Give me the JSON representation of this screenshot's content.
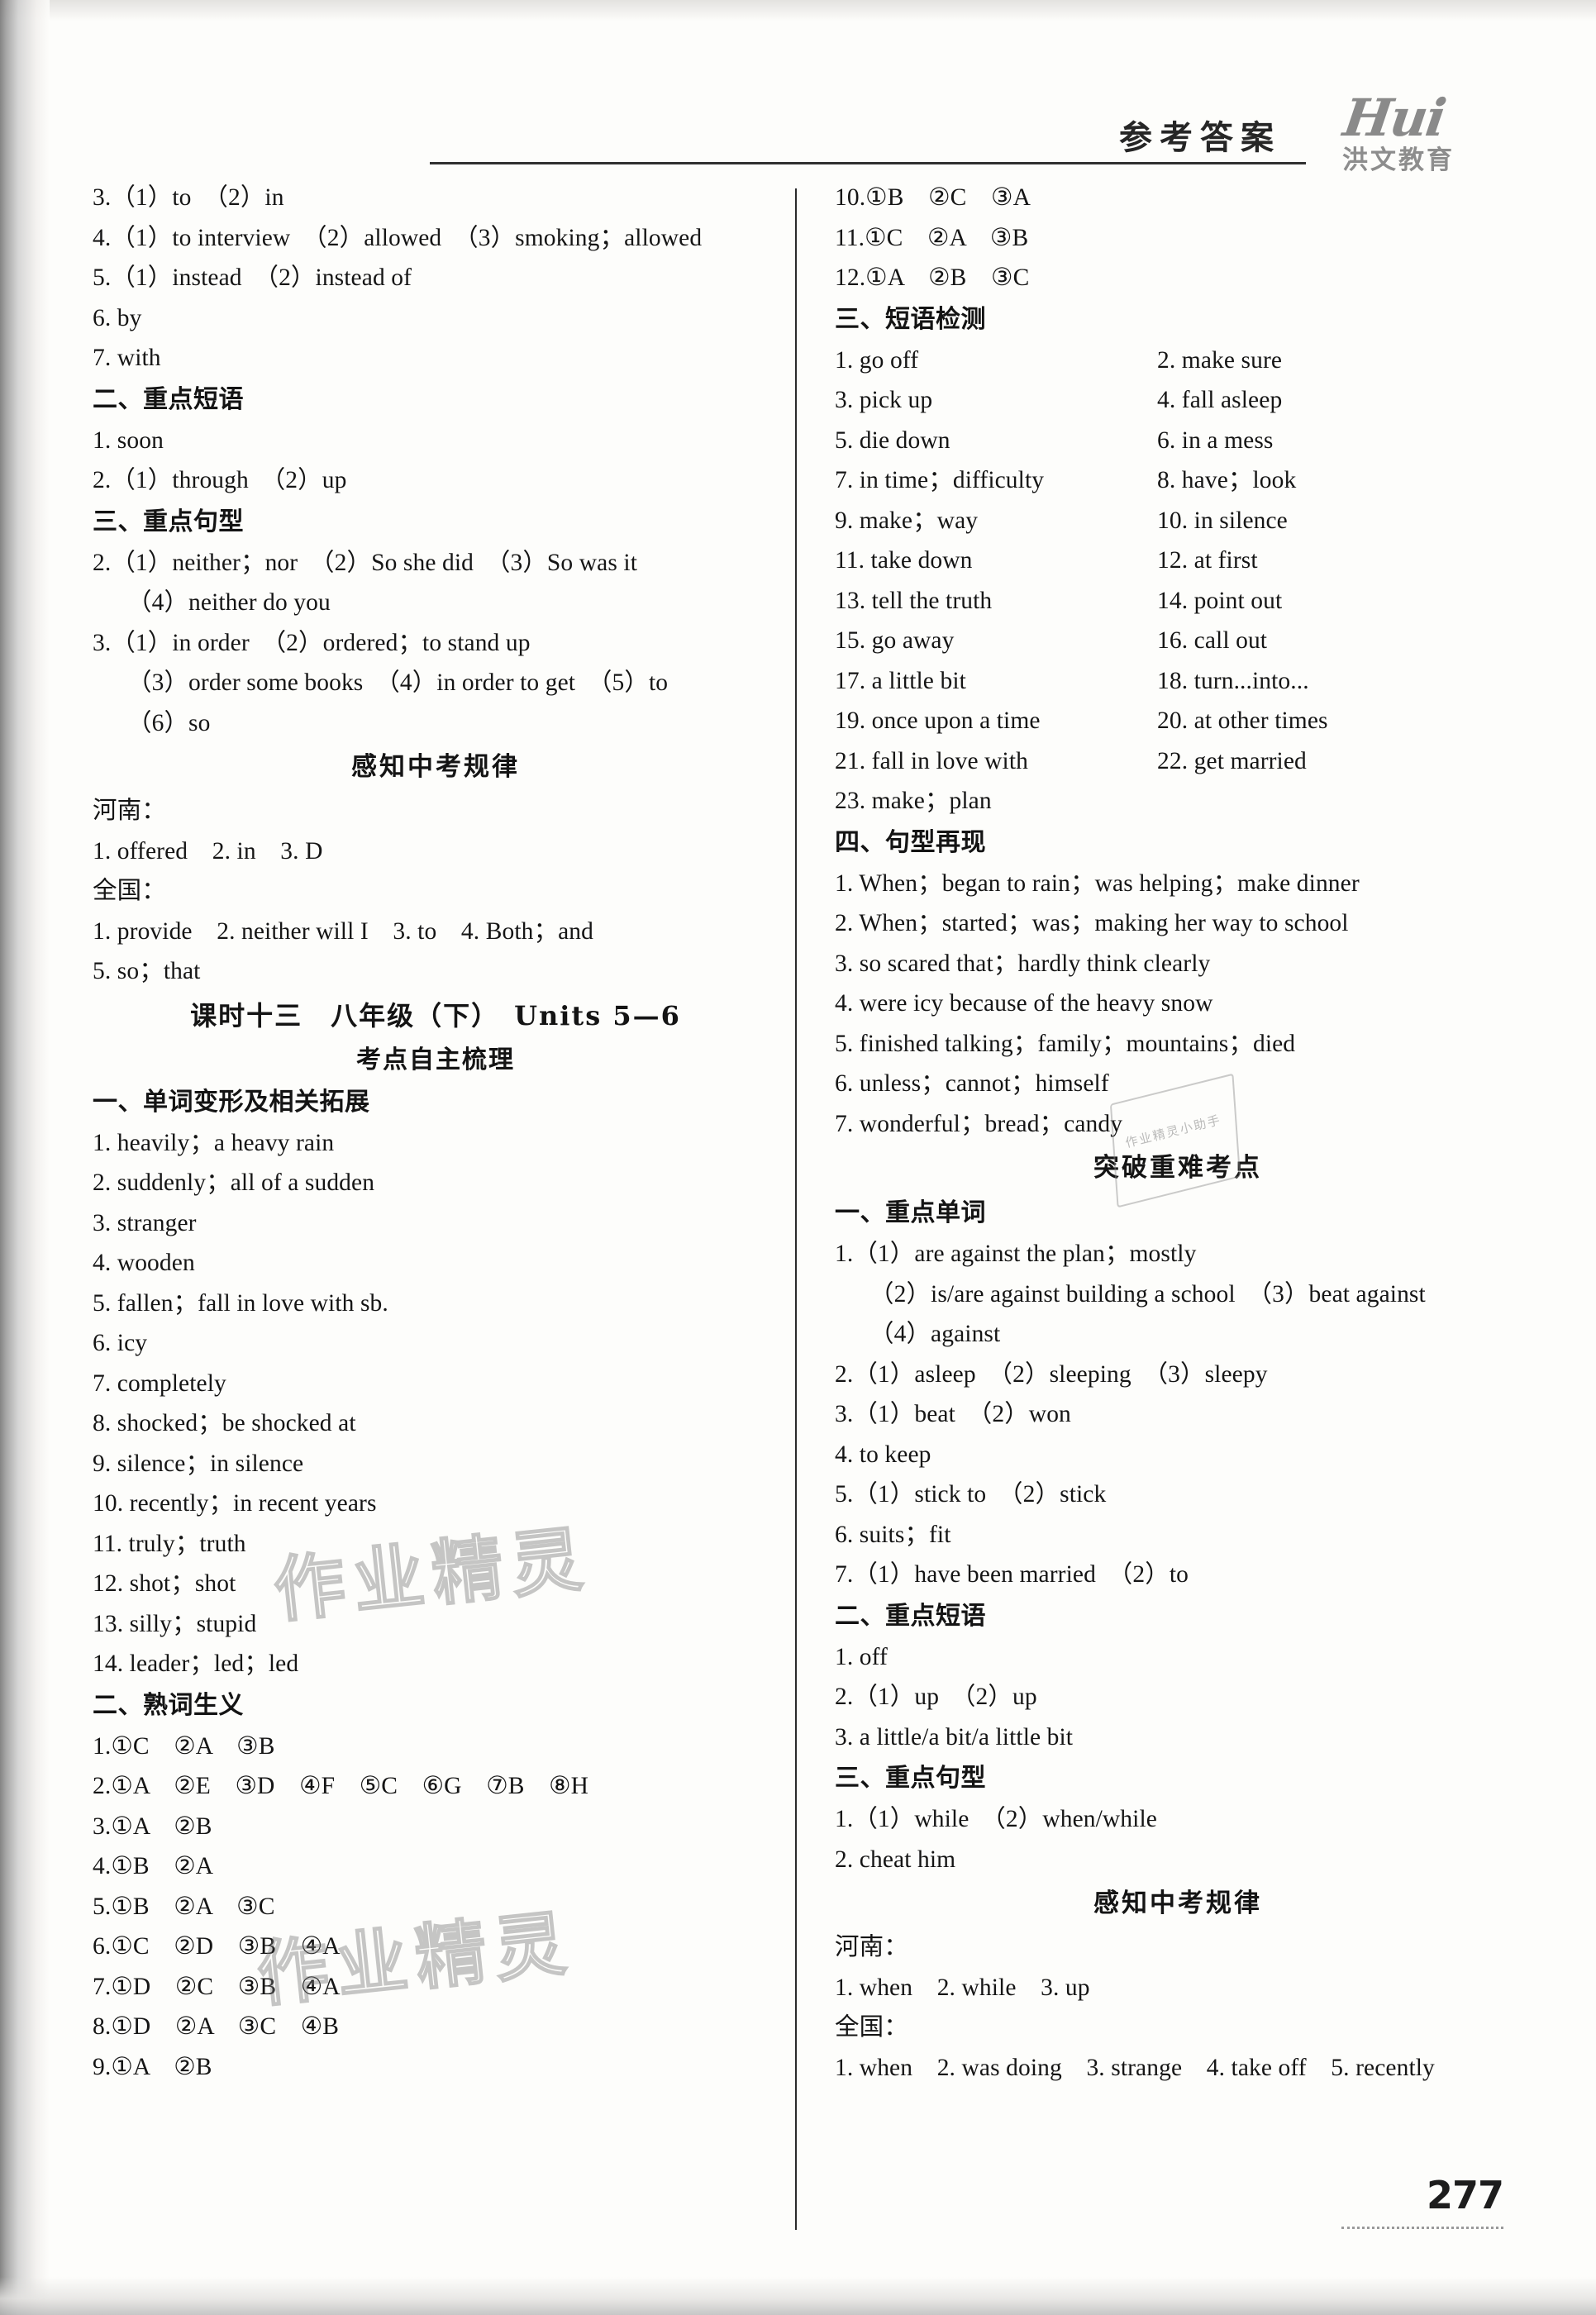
{
  "header": {
    "title": "参考答案",
    "logo_script": "Hui",
    "logo_sub": "洪文教育"
  },
  "page_number": "277",
  "watermarks": {
    "a": "作业精灵",
    "b": "作业精灵",
    "c": "作业精灵小助手"
  },
  "left_column": [
    {
      "type": "line",
      "text": "3.（1）to　（2）in"
    },
    {
      "type": "line",
      "text": "4.（1）to interview　（2）allowed　（3）smoking；allowed"
    },
    {
      "type": "line",
      "text": "5.（1）instead　（2）instead of"
    },
    {
      "type": "line",
      "text": "6. by"
    },
    {
      "type": "line",
      "text": "7. with"
    },
    {
      "type": "sec-head",
      "text": "二、重点短语"
    },
    {
      "type": "line",
      "text": "1. soon"
    },
    {
      "type": "line",
      "text": "2.（1）through　（2）up"
    },
    {
      "type": "sec-head",
      "text": "三、重点句型"
    },
    {
      "type": "line",
      "text": "2.（1）neither；nor　（2）So she did　（3）So was it"
    },
    {
      "type": "line-indent",
      "text": "（4）neither do you"
    },
    {
      "type": "line",
      "text": "3.（1）in order　（2）ordered；to stand up"
    },
    {
      "type": "line-indent",
      "text": "（3）order some books　（4）in order to get　（5）to"
    },
    {
      "type": "line-indent",
      "text": "（6）so"
    },
    {
      "type": "center-head",
      "text": "感知中考规律"
    },
    {
      "type": "line",
      "text": "河南："
    },
    {
      "type": "line",
      "text": "1. offered　2. in　3. D"
    },
    {
      "type": "line",
      "text": "全国："
    },
    {
      "type": "line",
      "text": "1. provide　2. neither will I　3. to　4. Both；and"
    },
    {
      "type": "line",
      "text": "5. so；that"
    },
    {
      "type": "center-head-serif",
      "text": "课时十三　八年级（下）　Units 5—6"
    },
    {
      "type": "center-sub",
      "text": "考点自主梳理"
    },
    {
      "type": "sec-head",
      "text": "一、单词变形及相关拓展"
    },
    {
      "type": "line",
      "text": "1. heavily；a heavy rain"
    },
    {
      "type": "line",
      "text": "2. suddenly；all of a sudden"
    },
    {
      "type": "line",
      "text": "3. stranger"
    },
    {
      "type": "line",
      "text": "4. wooden"
    },
    {
      "type": "line",
      "text": "5. fallen；fall in love with sb."
    },
    {
      "type": "line",
      "text": "6. icy"
    },
    {
      "type": "line",
      "text": "7. completely"
    },
    {
      "type": "line",
      "text": "8. shocked；be shocked at"
    },
    {
      "type": "line",
      "text": "9. silence；in silence"
    },
    {
      "type": "line",
      "text": "10. recently；in recent years"
    },
    {
      "type": "line",
      "text": "11. truly；truth"
    },
    {
      "type": "line",
      "text": "12. shot；shot"
    },
    {
      "type": "line",
      "text": "13. silly；stupid"
    },
    {
      "type": "line",
      "text": "14. leader；led；led"
    },
    {
      "type": "sec-head",
      "text": "二、熟词生义"
    },
    {
      "type": "line",
      "text": "1.①C　②A　③B"
    },
    {
      "type": "line",
      "text": "2.①A　②E　③D　④F　⑤C　⑥G　⑦B　⑧H"
    },
    {
      "type": "line",
      "text": "3.①A　②B"
    },
    {
      "type": "line",
      "text": "4.①B　②A"
    },
    {
      "type": "line",
      "text": "5.①B　②A　③C"
    },
    {
      "type": "line",
      "text": "6.①C　②D　③B　④A"
    },
    {
      "type": "line",
      "text": "7.①D　②C　③B　④A"
    },
    {
      "type": "line",
      "text": "8.①D　②A　③C　④B"
    },
    {
      "type": "line",
      "text": "9.①A　②B"
    }
  ],
  "right_column": [
    {
      "type": "line",
      "text": "10.①B　②C　③A"
    },
    {
      "type": "line",
      "text": "11.①C　②A　③B"
    },
    {
      "type": "line",
      "text": "12.①A　②B　③C"
    },
    {
      "type": "sec-head",
      "text": "三、短语检测"
    },
    {
      "type": "grid2",
      "left": "1. go off",
      "right": "2. make sure"
    },
    {
      "type": "grid2",
      "left": "3. pick up",
      "right": "4. fall asleep"
    },
    {
      "type": "grid2",
      "left": "5. die down",
      "right": "6. in a mess"
    },
    {
      "type": "grid2",
      "left": "7. in time；difficulty",
      "right": "8. have；look"
    },
    {
      "type": "grid2",
      "left": "9. make；way",
      "right": "10. in silence"
    },
    {
      "type": "grid2",
      "left": "11. take down",
      "right": "12. at first"
    },
    {
      "type": "grid2",
      "left": "13. tell the truth",
      "right": "14. point out"
    },
    {
      "type": "grid2",
      "left": "15. go away",
      "right": "16. call out"
    },
    {
      "type": "grid2",
      "left": "17. a little bit",
      "right": "18. turn...into..."
    },
    {
      "type": "grid2",
      "left": "19. once upon a time",
      "right": "20. at other times"
    },
    {
      "type": "grid2",
      "left": "21. fall in love with",
      "right": "22. get married"
    },
    {
      "type": "line",
      "text": "23. make；plan"
    },
    {
      "type": "sec-head",
      "text": "四、句型再现"
    },
    {
      "type": "line",
      "text": "1. When；began to rain；was helping；make dinner"
    },
    {
      "type": "line",
      "text": "2. When；started；was；making her way to school"
    },
    {
      "type": "line",
      "text": "3. so scared that；hardly think clearly"
    },
    {
      "type": "line",
      "text": "4. were icy because of the heavy snow"
    },
    {
      "type": "line",
      "text": "5. finished talking；family；mountains；died"
    },
    {
      "type": "line",
      "text": "6. unless；cannot；himself"
    },
    {
      "type": "line",
      "text": "7. wonderful；bread；candy"
    },
    {
      "type": "center-head",
      "text": "突破重难考点"
    },
    {
      "type": "sec-head",
      "text": "一、重点单词"
    },
    {
      "type": "line",
      "text": "1.（1）are against the plan；mostly"
    },
    {
      "type": "line-indent",
      "text": "（2）is/are against building a school　（3）beat against"
    },
    {
      "type": "line-indent",
      "text": "（4）against"
    },
    {
      "type": "line",
      "text": "2.（1）asleep　（2）sleeping　（3）sleepy"
    },
    {
      "type": "line",
      "text": "3.（1）beat　（2）won"
    },
    {
      "type": "line",
      "text": "4. to keep"
    },
    {
      "type": "line",
      "text": "5.（1）stick to　（2）stick"
    },
    {
      "type": "line",
      "text": "6. suits；fit"
    },
    {
      "type": "line",
      "text": "7.（1）have been married　（2）to"
    },
    {
      "type": "sec-head",
      "text": "二、重点短语"
    },
    {
      "type": "line",
      "text": "1. off"
    },
    {
      "type": "line",
      "text": "2.（1）up　（2）up"
    },
    {
      "type": "line",
      "text": "3. a little/a bit/a little bit"
    },
    {
      "type": "sec-head",
      "text": "三、重点句型"
    },
    {
      "type": "line",
      "text": "1.（1）while　（2）when/while"
    },
    {
      "type": "line",
      "text": "2. cheat him"
    },
    {
      "type": "center-head",
      "text": "感知中考规律"
    },
    {
      "type": "line",
      "text": "河南："
    },
    {
      "type": "line",
      "text": "1. when　2. while　3. up"
    },
    {
      "type": "line",
      "text": "全国："
    },
    {
      "type": "line",
      "text": "1. when　2. was doing　3. strange　4. take off　5. recently"
    }
  ]
}
